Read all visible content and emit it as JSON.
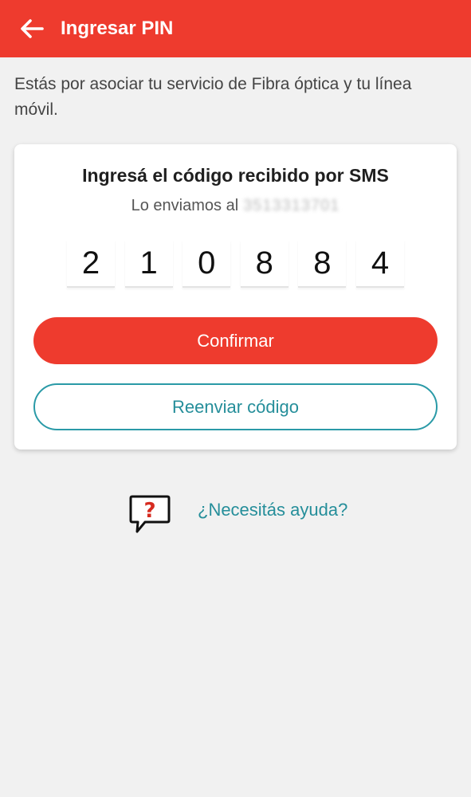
{
  "header": {
    "back_icon": "arrow-left-icon",
    "title": "Ingresar PIN",
    "bg_color": "#ee3b2e"
  },
  "intro_text": "Estás por asociar tu servicio de Fibra óptica y tu línea móvil.",
  "card": {
    "title": "Ingresá el código recibido por SMS",
    "subtitle_prefix": "Lo enviamos al",
    "phone_redacted": "3513313701",
    "pin_digits": [
      "2",
      "1",
      "0",
      "8",
      "8",
      "4"
    ],
    "confirm_label": "Confirmar",
    "resend_label": "Reenviar código"
  },
  "help": {
    "icon": "question-bubble-icon",
    "label": "¿Necesitás ayuda?"
  },
  "colors": {
    "primary": "#ee3b2e",
    "link": "#258e9a",
    "background": "#f1f1f1"
  }
}
